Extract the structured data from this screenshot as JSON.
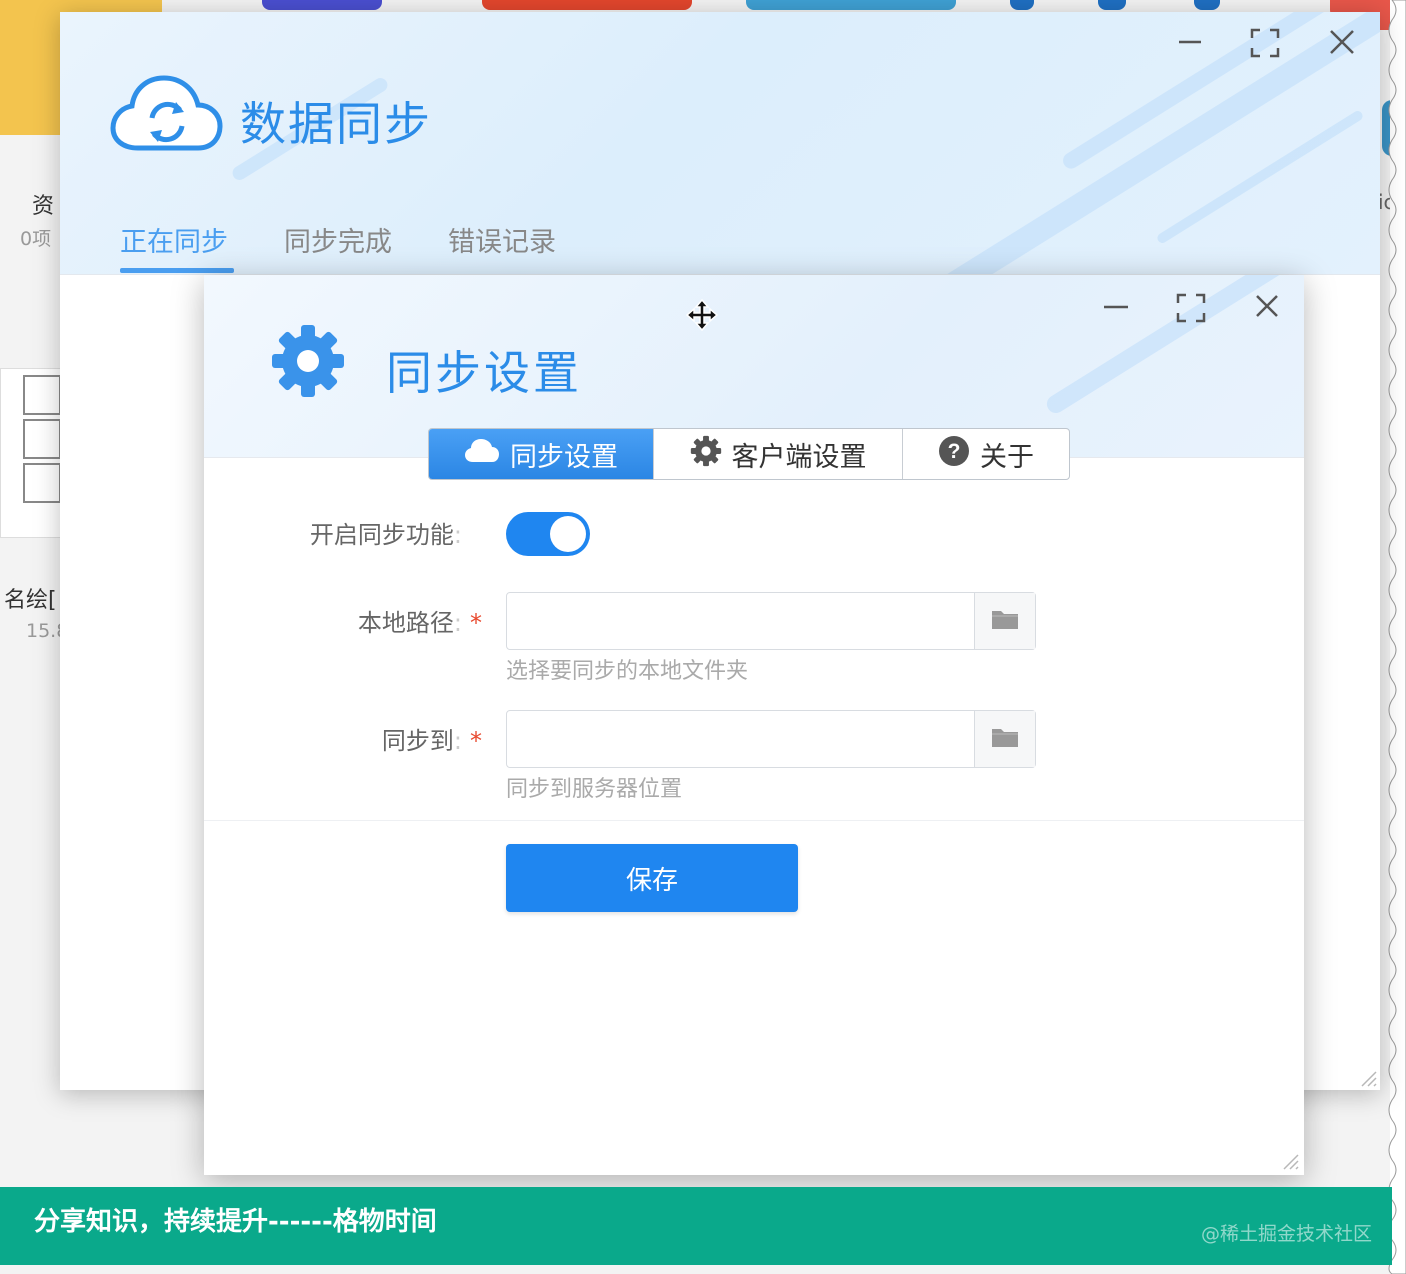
{
  "background_app": {
    "left_labels": [
      "资",
      "0项",
      "名绘[",
      "15.8"
    ],
    "right_labels": [
      "ic"
    ]
  },
  "sync_window": {
    "title": "数据同步",
    "icons": {
      "logo": "cloud-sync-icon",
      "minimize": "minimize-icon",
      "maximize": "maximize-icon",
      "close": "close-icon"
    },
    "tabs": [
      {
        "label": "正在同步",
        "active": true
      },
      {
        "label": "同步完成",
        "active": false
      },
      {
        "label": "错误记录",
        "active": false
      }
    ],
    "accent_color": "#4a9ef0"
  },
  "settings_dialog": {
    "title": "同步设置",
    "icons": {
      "logo": "gear-icon",
      "minimize": "minimize-icon",
      "maximize": "maximize-icon",
      "close": "close-icon",
      "cursor": "move-cursor-icon"
    },
    "segments": [
      {
        "label": "同步设置",
        "icon": "cloud-icon",
        "active": true
      },
      {
        "label": "客户端设置",
        "icon": "gear-icon",
        "active": false
      },
      {
        "label": "关于",
        "icon": "question-icon",
        "active": false
      }
    ],
    "form": {
      "enable_label": "开启同步功能",
      "enable_value": true,
      "local_path": {
        "label": "本地路径",
        "value": "",
        "hint": "选择要同步的本地文件夹",
        "required": true
      },
      "sync_to": {
        "label": "同步到",
        "value": "",
        "hint": "同步到服务器位置",
        "required": true
      },
      "colon": ":",
      "required_mark": "*"
    },
    "save_label": "保存",
    "primary_color": "#1f86f0"
  },
  "footer": {
    "text": "分享知识，持续提升------格物时间",
    "watermark": "@稀土掘金技术社区",
    "color": "#0aa98b"
  }
}
